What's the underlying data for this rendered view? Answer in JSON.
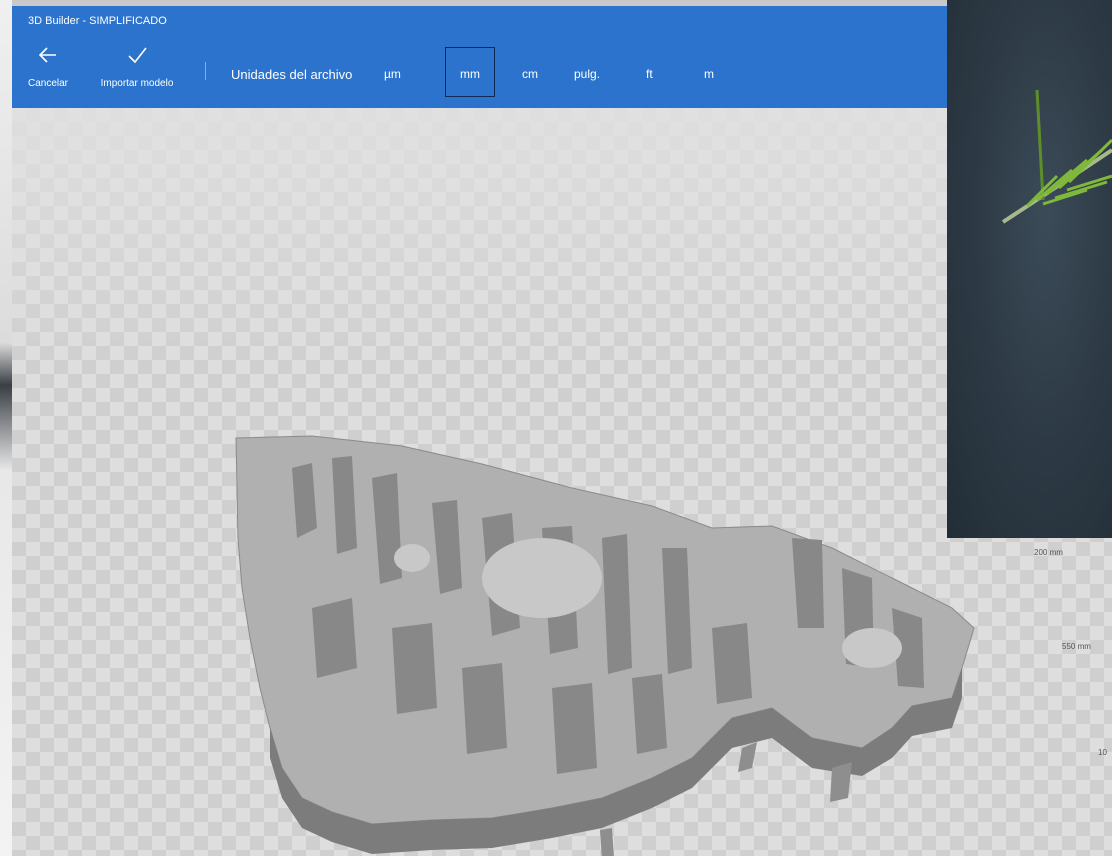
{
  "window": {
    "title": "3D Builder - SIMPLIFICADO"
  },
  "toolbar": {
    "cancel_label": "Cancelar",
    "import_label": "Importar modelo",
    "units_label": "Unidades del archivo",
    "units": [
      "µm",
      "mm",
      "cm",
      "pulg.",
      "ft",
      "m"
    ],
    "selected_unit": "mm"
  },
  "viewport": {
    "dimension_labels": [
      "200 mm",
      "550 mm",
      "10"
    ]
  },
  "icons": {
    "cancel": "arrow-left-icon",
    "import": "checkmark-icon"
  },
  "colors": {
    "accent": "#2b73cc",
    "model": "#9a9a9a",
    "photo_background": "#2d3a45",
    "leaf": "#7fb83a"
  }
}
